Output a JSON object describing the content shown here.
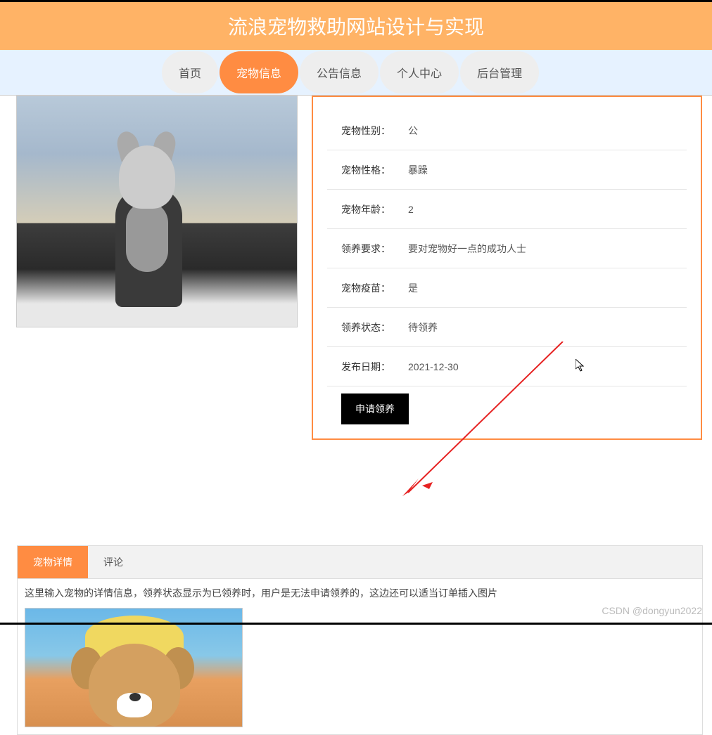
{
  "header": {
    "title": "流浪宠物救助网站设计与实现"
  },
  "nav": {
    "items": [
      {
        "label": "首页"
      },
      {
        "label": "宠物信息"
      },
      {
        "label": "公告信息"
      },
      {
        "label": "个人中心"
      },
      {
        "label": "后台管理"
      }
    ]
  },
  "pet": {
    "fields": [
      {
        "label": "宠物性别：",
        "value": "公"
      },
      {
        "label": "宠物性格：",
        "value": "暴躁"
      },
      {
        "label": "宠物年龄：",
        "value": "2"
      },
      {
        "label": "领养要求：",
        "value": "要对宠物好一点的成功人士"
      },
      {
        "label": "宠物疫苗：",
        "value": "是"
      },
      {
        "label": "领养状态：",
        "value": "待领养"
      },
      {
        "label": "发布日期：",
        "value": "2021-12-30"
      }
    ],
    "apply_btn": "申请领养"
  },
  "detail_tabs": {
    "tab1": "宠物详情",
    "tab2": "评论",
    "content": "这里输入宠物的详情信息，领养状态显示为已领养时，用户是无法申请领养的，这边还可以适当订单插入图片"
  },
  "watermark": "CSDN @dongyun2022"
}
